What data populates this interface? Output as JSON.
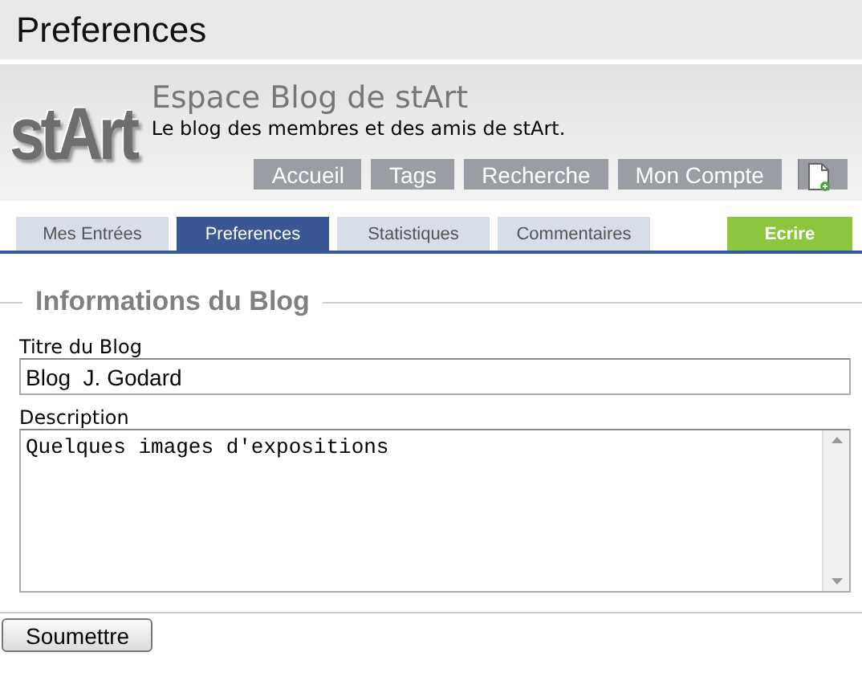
{
  "window": {
    "title": "Preferences"
  },
  "header": {
    "logo": "stArt",
    "site_title": "Espace Blog de stArt",
    "tagline": "Le blog des membres et des amis de stArt.",
    "nav": [
      {
        "label": "Accueil"
      },
      {
        "label": "Tags"
      },
      {
        "label": "Recherche"
      },
      {
        "label": "Mon Compte"
      }
    ]
  },
  "tabs": [
    {
      "label": "Mes Entrées",
      "kind": "tab",
      "selected": false
    },
    {
      "label": "Preferences",
      "kind": "tab",
      "selected": true
    },
    {
      "label": "Statistiques",
      "kind": "tab",
      "selected": false
    },
    {
      "label": "Commentaires",
      "kind": "tab",
      "selected": false
    },
    {
      "label": "Ecrire",
      "kind": "action"
    }
  ],
  "form": {
    "legend": "Informations du Blog",
    "fields": [
      {
        "label": "Titre du Blog",
        "kind": "text",
        "value": "Blog  J. Godard"
      },
      {
        "label": "Description",
        "kind": "textarea",
        "value": "Quelques images d'expositions"
      }
    ],
    "submit": "Soumettre"
  }
}
